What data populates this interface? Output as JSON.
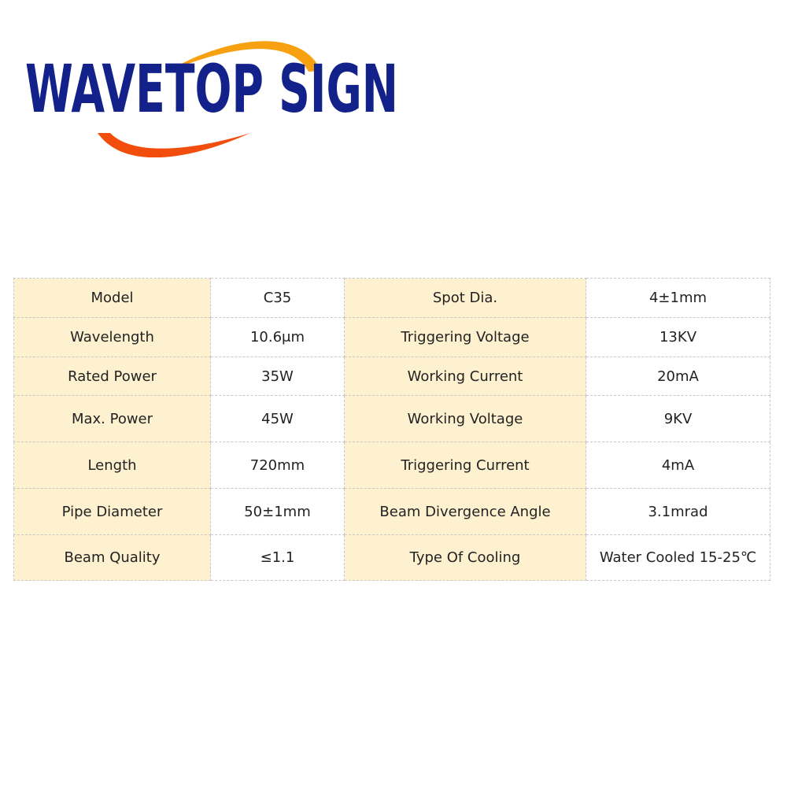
{
  "logo": {
    "text": "WAVETOP SIGN",
    "colors": {
      "text": "#13228a",
      "arc_top": "#f7a010",
      "arc_bottom": "#f24d0c"
    }
  },
  "table": {
    "key_bg": "#fdf1cf",
    "rows": [
      {
        "k1": "Model",
        "v1": "C35",
        "k2": "Spot Dia.",
        "v2": "4±1mm"
      },
      {
        "k1": "Wavelength",
        "v1": "10.6μm",
        "k2": "Triggering Voltage",
        "v2": "13KV"
      },
      {
        "k1": "Rated Power",
        "v1": "35W",
        "k2": "Working Current",
        "v2": "20mA"
      },
      {
        "k1": "Max. Power",
        "v1": "45W",
        "k2": "Working Voltage",
        "v2": "9KV"
      },
      {
        "k1": "Length",
        "v1": "720mm",
        "k2": "Triggering Current",
        "v2": "4mA"
      },
      {
        "k1": "Pipe Diameter",
        "v1": "50±1mm",
        "k2": "Beam Divergence Angle",
        "v2": "3.1mrad"
      },
      {
        "k1": "Beam Quality",
        "v1": "≤1.1",
        "k2": "Type Of Cooling",
        "v2": "Water Cooled 15-25℃"
      }
    ]
  }
}
